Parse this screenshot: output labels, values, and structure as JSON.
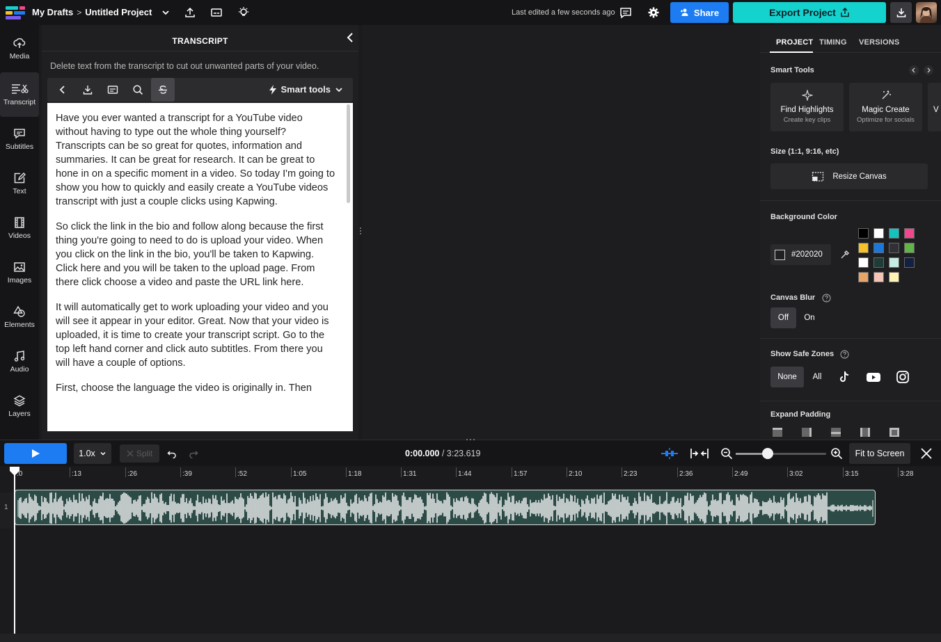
{
  "topbar": {
    "breadcrumb_root": "My Drafts",
    "breadcrumb_sep": ">",
    "project_name": "Untitled Project",
    "last_edited": "Last edited a few seconds ago",
    "share_label": "Share",
    "export_label": "Export Project",
    "colors": {
      "share": "#1d7cf2",
      "export": "#14d3cf"
    }
  },
  "leftnav": {
    "items": [
      {
        "label": "Media",
        "icon": "upload-cloud-icon"
      },
      {
        "label": "Transcript",
        "icon": "transcript-icon",
        "active": true
      },
      {
        "label": "Subtitles",
        "icon": "subtitles-icon"
      },
      {
        "label": "Text",
        "icon": "text-edit-icon"
      },
      {
        "label": "Videos",
        "icon": "film-icon"
      },
      {
        "label": "Images",
        "icon": "image-icon"
      },
      {
        "label": "Elements",
        "icon": "shapes-icon"
      },
      {
        "label": "Audio",
        "icon": "music-note-icon"
      },
      {
        "label": "Layers",
        "icon": "layers-icon"
      }
    ]
  },
  "transcript": {
    "title": "TRANSCRIPT",
    "description": "Delete text from the transcript to cut out unwanted parts of your video.",
    "smart_tools_label": "Smart tools",
    "paragraphs": [
      "Have you ever wanted a transcript for a YouTube video without having to type out the whole thing yourself? Transcripts can be so great for quotes, information and summaries. It can be great for research. It can be great to hone in on a specific moment in a video. So today I'm going to show you how to quickly and easily create a YouTube videos transcript with just a couple clicks using Kapwing.",
      "So click the link in the bio and follow along because the first thing you're going to need to do is upload your video. When you click on the link in the bio, you'll be taken to Kapwing. Click here and you will be taken to the upload page. From there click choose a video and paste the URL link here.",
      "It will automatically get to work uploading your video and you will see it appear in your editor. Great. Now that your video is uploaded, it is time to create your transcript script. Go to the top left hand corner and click auto subtitles. From there you will have a couple of options.",
      "First, choose the language the video is originally in. Then"
    ]
  },
  "rightpanel": {
    "tabs": [
      "PROJECT",
      "TIMING",
      "VERSIONS"
    ],
    "active_tab": "PROJECT",
    "smart_tools_label": "Smart Tools",
    "cards": [
      {
        "title": "Find Highlights",
        "subtitle": "Create key clips",
        "icon": "sparkle-icon"
      },
      {
        "title": "Magic Create",
        "subtitle": "Optimize for socials",
        "icon": "magic-wand-icon"
      },
      {
        "title": "V",
        "subtitle": "",
        "icon": ""
      }
    ],
    "size_label": "Size (1:1, 9:16, etc)",
    "resize_label": "Resize Canvas",
    "bg_color_label": "Background Color",
    "bg_hex": "#202020",
    "swatches": [
      "#000000",
      "#ffffff",
      "#14c3c0",
      "#f0478d",
      "#f6c12a",
      "#1c78d8",
      "#303036",
      "#62b44a",
      "#ffffff",
      "#1f3c38",
      "#c6ece4",
      "#142040",
      "#e8a56a",
      "#f6c4b4",
      "#fdf3b4"
    ],
    "canvas_blur_label": "Canvas Blur",
    "blur_off": "Off",
    "blur_on": "On",
    "safe_zones_label": "Show Safe Zones",
    "safe_none": "None",
    "safe_all": "All",
    "expand_padding_label": "Expand Padding"
  },
  "timeline": {
    "speed": "1.0x",
    "split_label": "Split",
    "current_time": "0:00.000",
    "total_time": "/ 3:23.619",
    "fit_label": "Fit to Screen",
    "zoom_level": 0.35,
    "track_number": "1",
    "ticks": [
      ":0",
      ":13",
      ":26",
      ":39",
      ":52",
      "1:05",
      "1:18",
      "1:31",
      "1:44",
      "1:57",
      "2:10",
      "2:23",
      "2:36",
      "2:49",
      "3:02",
      "3:15",
      "3:28"
    ]
  }
}
